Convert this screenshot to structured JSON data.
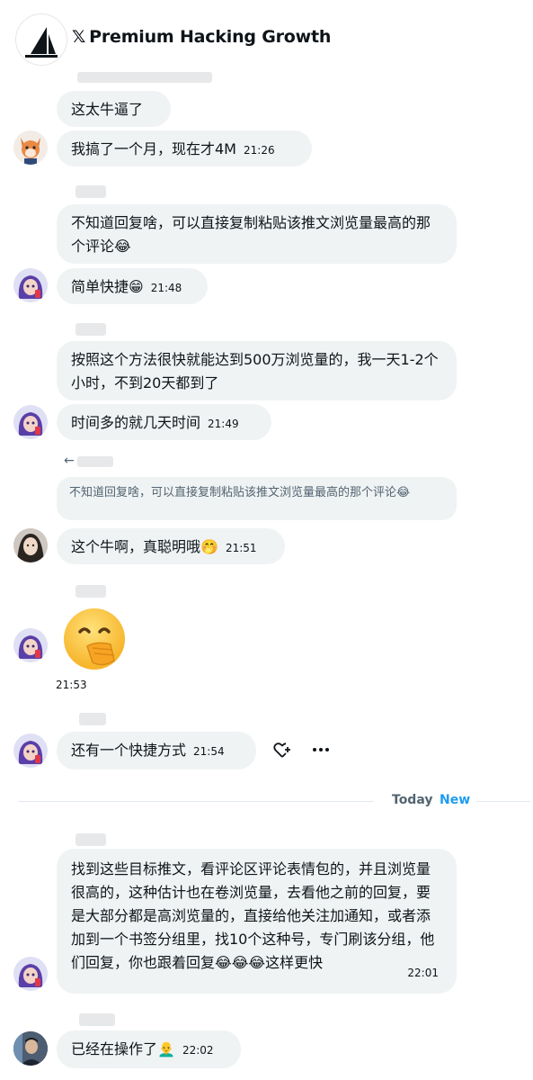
{
  "header": {
    "x_mark": "𝕏",
    "title": "Premium Hacking Growth"
  },
  "messages": {
    "m1": {
      "text": "这太牛逼了"
    },
    "m2": {
      "text": "我搞了一个月，现在才4M",
      "time": "21:26"
    },
    "m3": {
      "text": "不知道回复啥，可以直接复制粘贴该推文浏览量最高的那个评论😂"
    },
    "m4": {
      "text": "简单快捷😁",
      "time": "21:48"
    },
    "m5": {
      "text": "按照这个方法很快就能达到500万浏览量的，我一天1-2个小时，不到20天都到了"
    },
    "m6": {
      "text": "时间多的就几天时间",
      "time": "21:49"
    },
    "m7_quote": {
      "text": "不知道回复啥，可以直接复制粘贴该推文浏览量最高的那个评论😂"
    },
    "m7": {
      "text": "这个牛啊，真聪明哦🤭",
      "time": "21:51"
    },
    "m8": {
      "emoji": "🤭",
      "time": "21:53"
    },
    "m9": {
      "text": "还有一个快捷方式",
      "time": "21:54"
    },
    "m10": {
      "text": "找到这些目标推文，看评论区评论表情包的，并且浏览量很高的，这种估计也在卷浏览量，去看他之前的回复，要是大部分都是高浏览量的，直接给他关注加通知，或者添加到一个书签分组里，找10个这种号，专门刷该分组，他们回复，你也跟着回复😂😂😂这样更快",
      "time": "22:01"
    },
    "m11": {
      "text": "已经在操作了👨‍🦲",
      "time": "22:02"
    }
  },
  "divider": {
    "today": "Today",
    "new": "New"
  },
  "actions": {
    "react_icon": "heart-plus-icon",
    "more_icon": "more-dots-icon",
    "reply_arrow_icon": "reply-arrow-icon"
  }
}
